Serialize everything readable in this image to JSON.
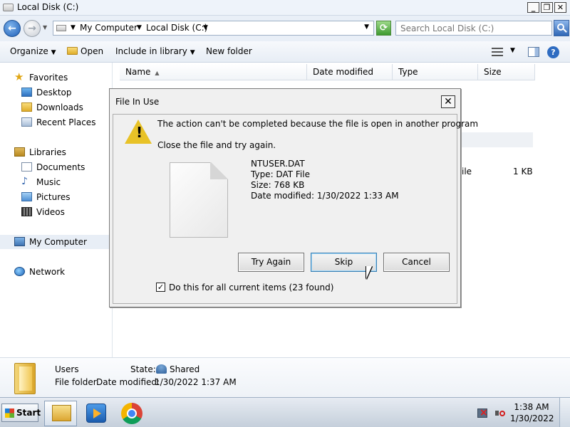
{
  "window": {
    "title": "Local Disk (C:)",
    "minimize": "_",
    "maximize": "❐",
    "close": "✕"
  },
  "address_bar": {
    "crumbs": [
      "My Computer",
      "Local Disk (C:)"
    ],
    "search_placeholder": "Search Local Disk (C:)"
  },
  "toolbar": {
    "organize": "Organize",
    "open": "Open",
    "include_in_library": "Include in library",
    "new_folder": "New folder"
  },
  "sidebar": {
    "favorites": "Favorites",
    "desktop": "Desktop",
    "downloads": "Downloads",
    "recent_places": "Recent Places",
    "libraries": "Libraries",
    "documents": "Documents",
    "music": "Music",
    "pictures": "Pictures",
    "videos": "Videos",
    "my_computer": "My Computer",
    "network": "Network"
  },
  "columns": {
    "name": "Name",
    "date_modified": "Date modified",
    "type": "Type",
    "size": "Size"
  },
  "file_list_fragments": {
    "type_fragment": "ile",
    "size": "1 KB"
  },
  "dialog": {
    "title": "File In Use",
    "message": "The action can't be completed because the file is open in another program",
    "instruction": "Close the file and try again.",
    "file_name": "NTUSER.DAT",
    "file_type": "Type: DAT File",
    "file_size": "Size: 768 KB",
    "file_date": "Date modified: 1/30/2022 1:33 AM",
    "try_again": "Try Again",
    "skip": "Skip",
    "cancel": "Cancel",
    "checkbox_label": "Do this for all current items (23 found)",
    "checkbox_checked": true,
    "close": "✕"
  },
  "details": {
    "name": "Users",
    "kind": "File folder",
    "state_label": "State:",
    "state_value": "Shared",
    "date_label": "Date modified:",
    "date_value": "1/30/2022 1:37 AM"
  },
  "taskbar": {
    "start": "Start",
    "time": "1:38 AM",
    "date": "1/30/2022"
  }
}
